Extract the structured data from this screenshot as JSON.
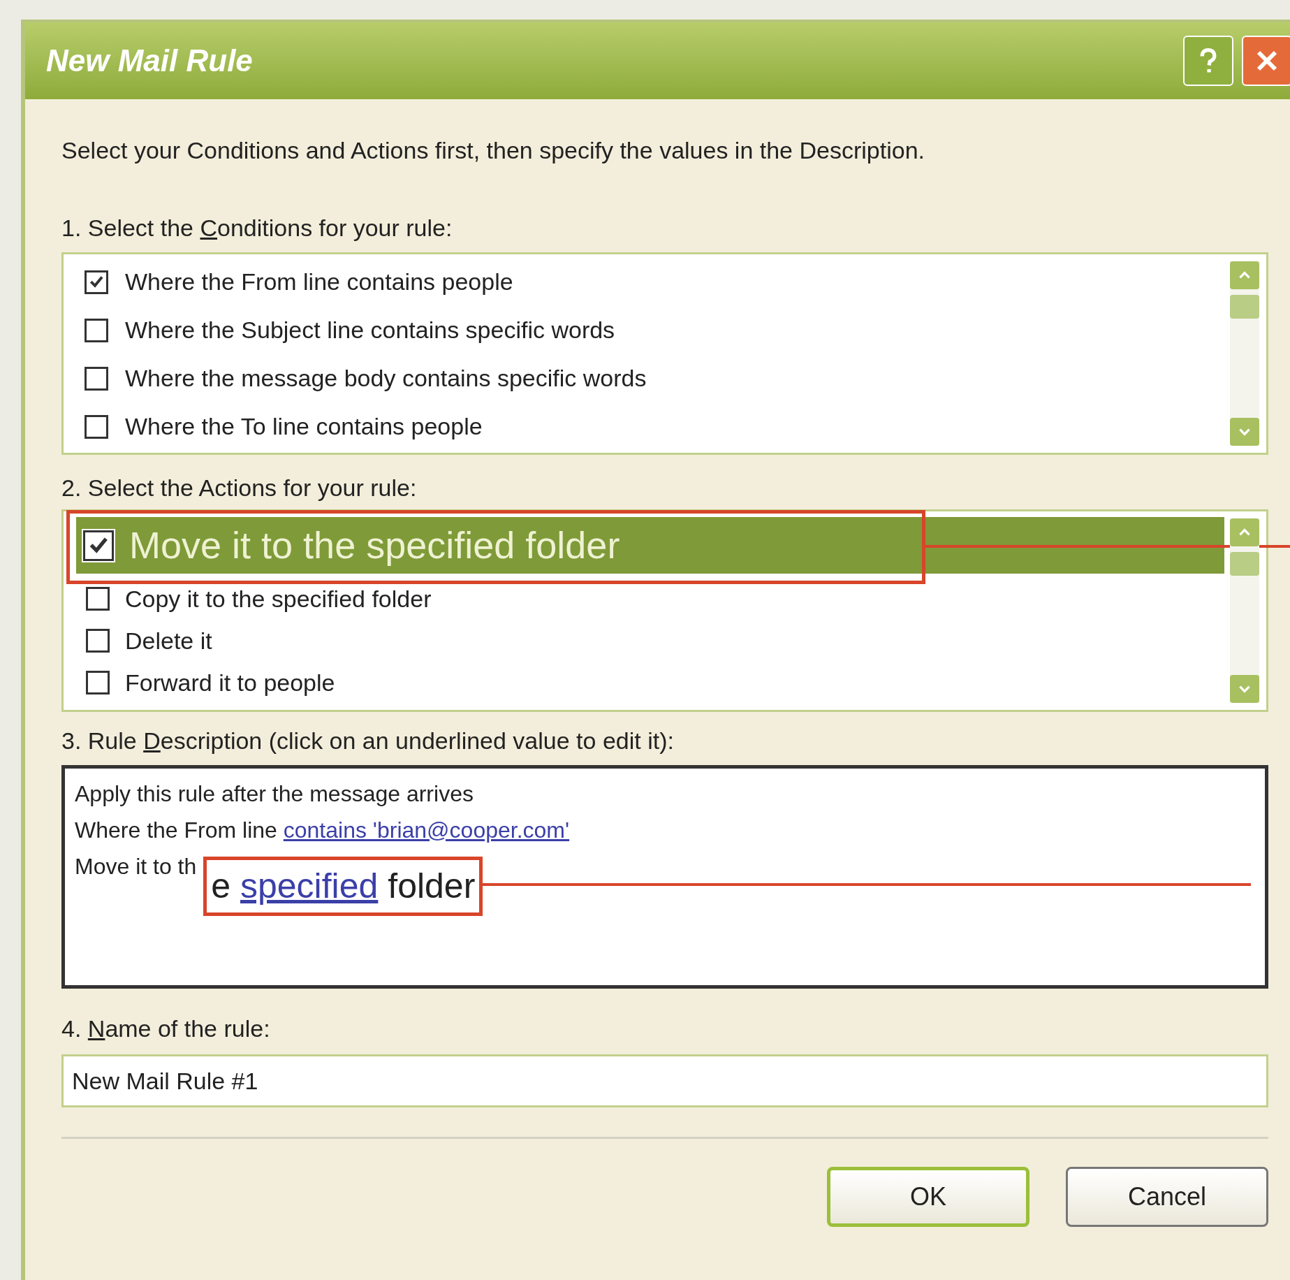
{
  "window": {
    "title": "New Mail Rule"
  },
  "instructions": "Select your Conditions and Actions first, then specify the values in the Description.",
  "conditions": {
    "label": {
      "before": "1. Select the ",
      "key": "C",
      "after": "onditions for your rule:"
    },
    "items": [
      {
        "text": "Where the From line contains people",
        "checked": true
      },
      {
        "text": "Where the Subject line contains specific words",
        "checked": false
      },
      {
        "text": "Where the message body contains specific words",
        "checked": false
      },
      {
        "text": "Where the To line contains people",
        "checked": false
      }
    ]
  },
  "actions": {
    "label": {
      "before": "2. Select the Actions for your rule:"
    },
    "items": [
      {
        "text": "Move it to the specified folder",
        "checked": true,
        "selected": true,
        "magnified": true
      },
      {
        "text": "Copy it to the specified folder",
        "checked": false,
        "selected": false,
        "magnified": false
      },
      {
        "text": "Delete it",
        "checked": false,
        "selected": false,
        "magnified": false
      },
      {
        "text": "Forward it to people",
        "checked": false,
        "selected": false,
        "magnified": false
      }
    ]
  },
  "description": {
    "label": {
      "before": "3. Rule ",
      "key": "D",
      "after": "escription (click on an underlined value to edit it):"
    },
    "lines": [
      {
        "parts": [
          {
            "text": "Apply this rule after the message arrives",
            "link": false
          }
        ]
      },
      {
        "parts": [
          {
            "text": "Where the From line ",
            "link": false
          },
          {
            "text": "contains 'brian@cooper.com'",
            "link": true
          }
        ]
      },
      {
        "parts": [
          {
            "text": "Move it to th",
            "link": false
          }
        ],
        "callout": [
          {
            "text": "e ",
            "link": false
          },
          {
            "text": "specified",
            "link": true
          },
          {
            "text": " folder",
            "link": false
          }
        ]
      }
    ]
  },
  "name": {
    "label": {
      "before": "4. ",
      "key": "N",
      "after": "ame of the rule:"
    },
    "value": "New Mail Rule #1"
  },
  "buttons": [
    {
      "label": "OK",
      "default": true
    },
    {
      "label": "Cancel",
      "default": false
    }
  ]
}
